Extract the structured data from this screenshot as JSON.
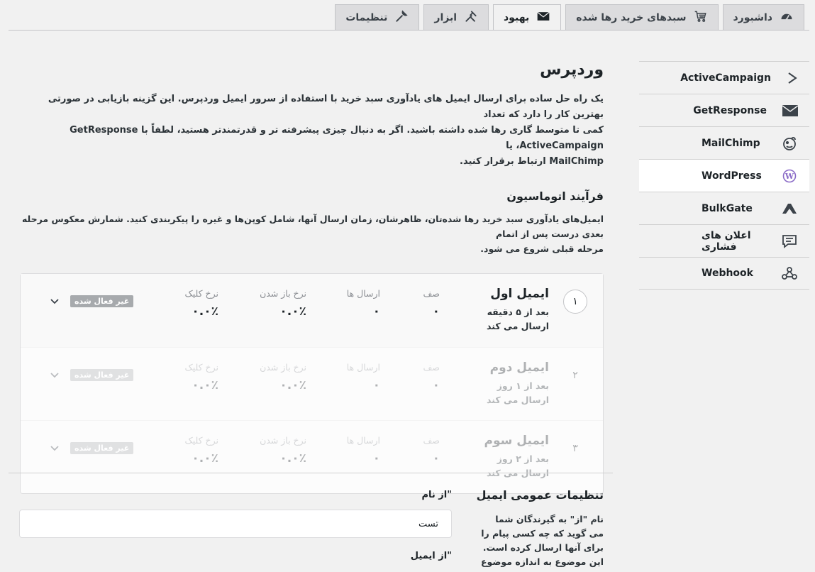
{
  "tabs": [
    {
      "label": "داشبورد",
      "icon": "gauge-icon"
    },
    {
      "label": "سبدهای خرید رها شده",
      "icon": "cart-icon"
    },
    {
      "label": "بهبود",
      "icon": "envelope-icon"
    },
    {
      "label": "ابزار",
      "icon": "tools-icon"
    },
    {
      "label": "تنظیمات",
      "icon": "wrench-icon"
    }
  ],
  "sidebar": {
    "items": [
      {
        "label": "ActiveCampaign",
        "icon": "activecampaign-icon"
      },
      {
        "label": "GetResponse",
        "icon": "envelope-icon"
      },
      {
        "label": "MailChimp",
        "icon": "mailchimp-icon"
      },
      {
        "label": "WordPress",
        "icon": "wordpress-icon"
      },
      {
        "label": "BulkGate",
        "icon": "bulkgate-icon"
      },
      {
        "label": "اعلان های فشاری",
        "icon": "chat-icon"
      },
      {
        "label": "Webhook",
        "icon": "webhook-icon"
      }
    ]
  },
  "main": {
    "title": "وردپرس",
    "intro_1": "یک راه حل ساده برای ارسال ایمیل های یادآوری سبد خرید با استفاده از سرور ایمیل وردپرس. این گزینه بازیابی در صورتی بهترین کار را دارد که تعداد",
    "intro_2": "کمی تا متوسط گاری رها شده داشته باشید. اگر به دنبال چیزی پیشرفته تر و قدرتمندتر هستید، لطفاً با GetResponse ،ActiveCampaign یا",
    "intro_3": "MailChimp ارتباط برقرار کنید.",
    "automation_title": "فرآیند اتوماسیون",
    "automation_desc_1": "ایمیل‌های یادآوری سبد خرید رها شده‌تان، ظاهرشان، زمان ارسال آنها، شامل کوپن‌ها و غیره را پیکربندی کنید. شمارش معکوس مرحله بعدی درست پس از اتمام",
    "automation_desc_2": "مرحله قبلی شروع می شود.",
    "stat_labels": {
      "queue": "صف",
      "sent": "ارسال ها",
      "open": "نرخ باز شدن",
      "click": "نرخ کلیک"
    },
    "emails": [
      {
        "num": "۱",
        "title": "ایمیل اول",
        "subtitle": "بعد از ۵ دقیقه ارسال می کند",
        "queue": "۰",
        "sent": "۰",
        "open": "۰.۰٪",
        "click": "۰.۰٪",
        "badge": "غیر فعال شده"
      },
      {
        "num": "۲",
        "title": "ایمیل دوم",
        "subtitle": "بعد از ۱ روز ارسال می کند",
        "queue": "۰",
        "sent": "۰",
        "open": "۰.۰٪",
        "click": "۰.۰٪",
        "badge": "غیر فعال شده"
      },
      {
        "num": "۳",
        "title": "ایمیل سوم",
        "subtitle": "بعد از ۲ روز ارسال می کند",
        "queue": "۰",
        "sent": "۰",
        "open": "۰.۰٪",
        "click": "۰.۰٪",
        "badge": "غیر فعال شده"
      }
    ]
  },
  "general": {
    "title": "تنظیمات عمومی ایمیل",
    "desc": "نام \"از\" به گیرندگان شما می گوید که چه کسی پیام را برای آنها ارسال کرده است. این موضوع به اندازه موضوع شما مهم است و می تواند",
    "from_name_label": "\"از نام",
    "from_name_value": "تست",
    "from_email_label": "\"از ایمیل"
  }
}
